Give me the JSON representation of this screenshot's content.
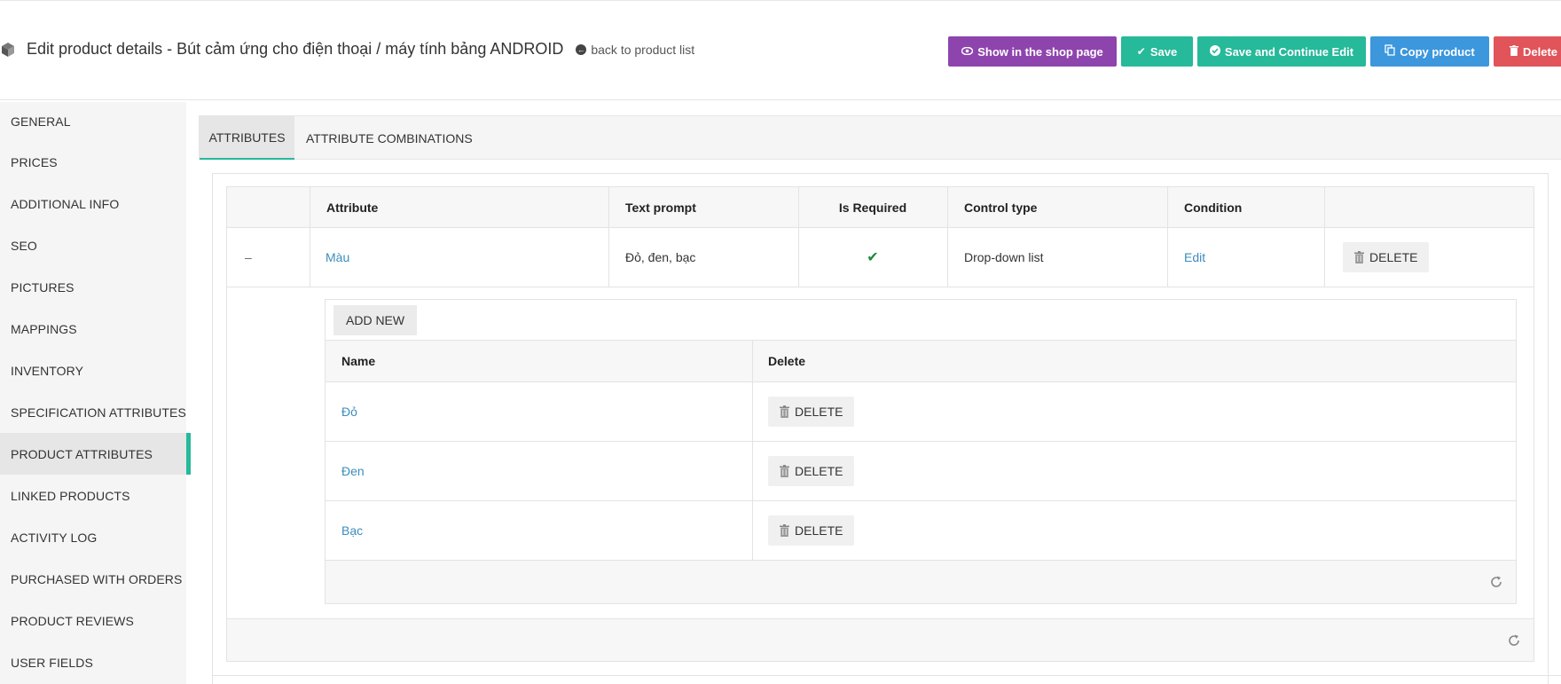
{
  "header": {
    "title": "Edit product details - Bút cảm ứng cho điện thoại / máy tính bảng ANDROID",
    "back_link": "back to product list",
    "buttons": {
      "show_in_shop": "Show in the shop page",
      "save": "Save",
      "save_continue": "Save and Continue Edit",
      "copy_product": "Copy product",
      "delete": "Delete"
    }
  },
  "sidebar": {
    "items": [
      {
        "label": "GENERAL"
      },
      {
        "label": "PRICES"
      },
      {
        "label": "ADDITIONAL INFO"
      },
      {
        "label": "SEO"
      },
      {
        "label": "PICTURES"
      },
      {
        "label": "MAPPINGS"
      },
      {
        "label": "INVENTORY"
      },
      {
        "label": "SPECIFICATION ATTRIBUTES"
      },
      {
        "label": "PRODUCT ATTRIBUTES"
      },
      {
        "label": "LINKED PRODUCTS"
      },
      {
        "label": "ACTIVITY LOG"
      },
      {
        "label": "PURCHASED WITH ORDERS"
      },
      {
        "label": "PRODUCT REVIEWS"
      },
      {
        "label": "USER FIELDS"
      }
    ],
    "active": "PRODUCT ATTRIBUTES"
  },
  "tabs": [
    {
      "label": "ATTRIBUTES"
    },
    {
      "label": "ATTRIBUTE COMBINATIONS"
    }
  ],
  "attributes_grid": {
    "columns": [
      "Attribute",
      "Text prompt",
      "Is Required",
      "Control type",
      "Condition"
    ],
    "rows": [
      {
        "expander": "–",
        "attribute": "Màu",
        "text_prompt": "Đỏ, đen, bạc",
        "is_required": "✔",
        "control_type": "Drop-down list",
        "condition": "Edit",
        "delete_label": "DELETE"
      }
    ]
  },
  "values_grid": {
    "add_new": "ADD NEW",
    "columns": [
      "Name",
      "Delete"
    ],
    "rows": [
      {
        "name": "Đỏ",
        "delete_label": "DELETE"
      },
      {
        "name": "Đen",
        "delete_label": "DELETE"
      },
      {
        "name": "Bạc",
        "delete_label": "DELETE"
      }
    ]
  },
  "colors": {
    "accent": "#26b99a",
    "purple": "#8e44ad",
    "blue": "#3c97dd",
    "red": "#e0545a",
    "link": "#3c8dbc"
  }
}
